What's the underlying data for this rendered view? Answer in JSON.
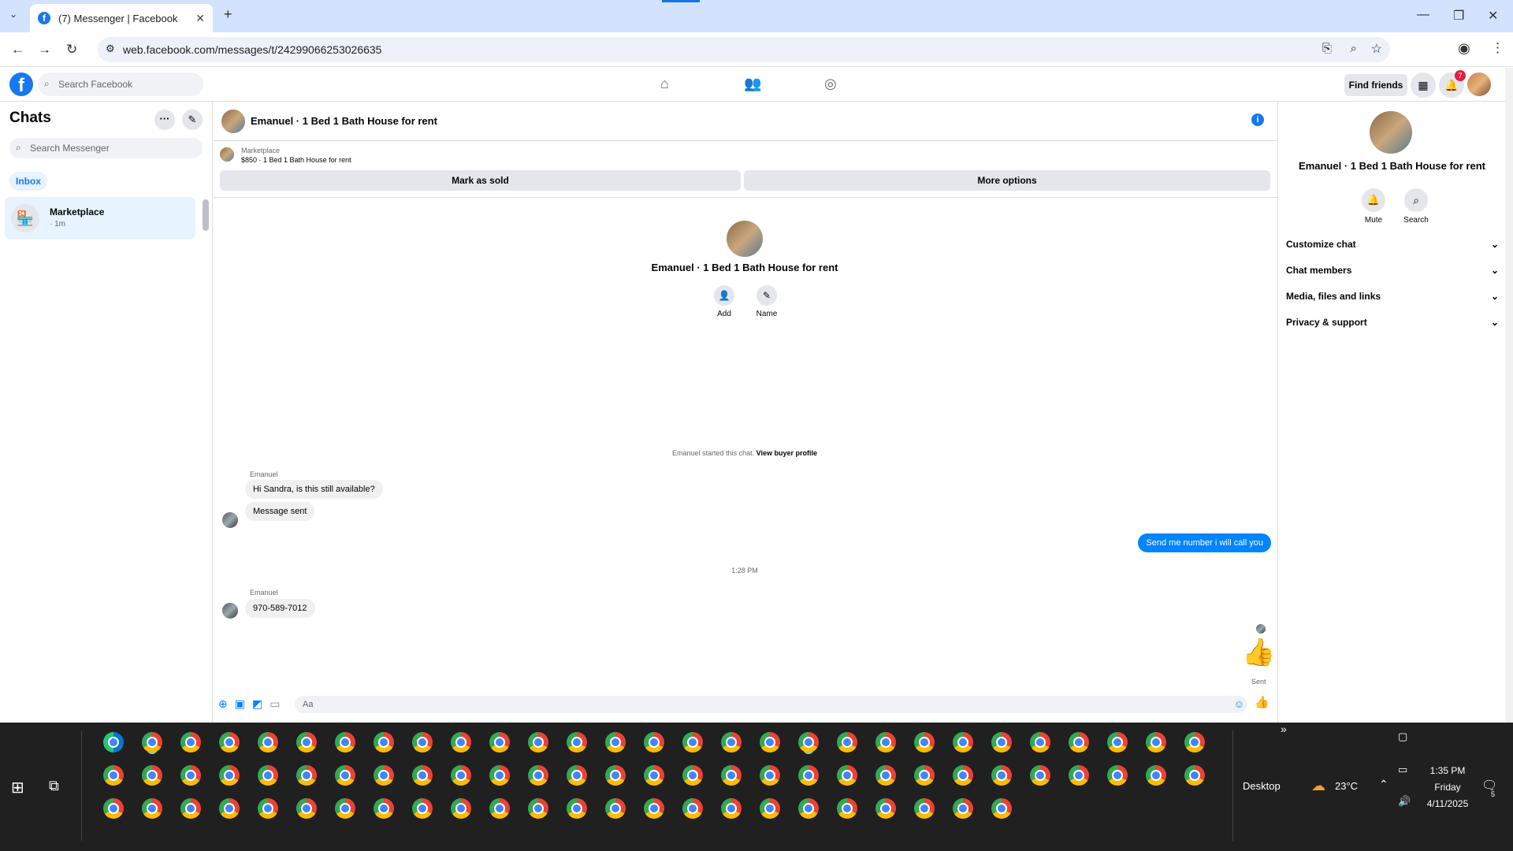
{
  "browser": {
    "tab_title": "(7) Messenger | Facebook",
    "url": "web.facebook.com/messages/t/24299066253026635"
  },
  "fb": {
    "search_placeholder": "Search Facebook",
    "find_friends": "Find friends",
    "notification_count": "7"
  },
  "sidebar": {
    "title": "Chats",
    "search_placeholder": "Search Messenger",
    "filter_inbox": "Inbox",
    "chats": [
      {
        "name": "Marketplace",
        "time": "· 1m"
      }
    ]
  },
  "conversation": {
    "title": "Emanuel · 1 Bed 1 Bath House for rent",
    "marketplace_label": "Marketplace",
    "listing": "$850 · 1 Bed 1 Bath House for rent",
    "mark_sold": "Mark as sold",
    "more_options": "More options",
    "center_title": "Emanuel · 1 Bed 1 Bath House for rent",
    "add_label": "Add",
    "name_label": "Name",
    "started_text": "Emanuel started this chat.",
    "view_buyer": "View buyer profile",
    "messages": [
      {
        "sender": "Emanuel",
        "text": "Hi Sandra, is this still available?"
      },
      {
        "sender": "",
        "text": "Message sent"
      },
      {
        "sender": "me",
        "text": "Send me number i will call you"
      },
      {
        "time": "1:28 PM"
      },
      {
        "sender": "Emanuel",
        "text": "970-589-7012"
      }
    ],
    "sent_status": "Sent",
    "composer_placeholder": "Aa"
  },
  "details": {
    "title": "Emanuel · 1 Bed 1 Bath House for rent",
    "mute": "Mute",
    "search": "Search",
    "sections": [
      "Customize chat",
      "Chat members",
      "Media, files and links",
      "Privacy & support"
    ]
  },
  "taskbar": {
    "desktop_label": "Desktop",
    "temperature": "23°C",
    "time": "1:35 PM",
    "day": "Friday",
    "date": "4/11/2025",
    "notif_count": "5"
  },
  "colors": {
    "accent": "#1877f2",
    "bubble_sent": "#0084ff",
    "taskbar": "#202020"
  }
}
